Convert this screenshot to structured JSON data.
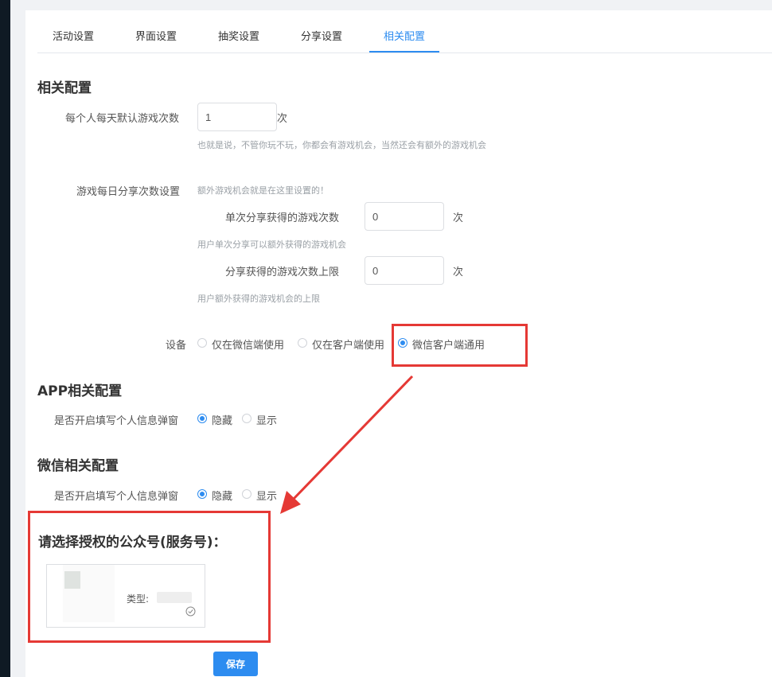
{
  "tabs": [
    {
      "label": "活动设置"
    },
    {
      "label": "界面设置"
    },
    {
      "label": "抽奖设置"
    },
    {
      "label": "分享设置"
    },
    {
      "label": "相关配置"
    }
  ],
  "related": {
    "title": "相关配置",
    "daily_plays_label": "每个人每天默认游戏次数",
    "daily_plays_value": "1",
    "daily_plays_unit": "次",
    "daily_plays_hint": "也就是说，不管你玩不玩，你都会有游戏机会，当然还会有额外的游戏机会",
    "share_label": "游戏每日分享次数设置",
    "share_desc": "额外游戏机会就是在这里设置的！",
    "single_share_label": "单次分享获得的游戏次数",
    "single_share_value": "0",
    "single_share_unit": "次",
    "single_share_hint": "用户单次分享可以额外获得的游戏机会",
    "share_limit_label": "分享获得的游戏次数上限",
    "share_limit_value": "0",
    "share_limit_unit": "次",
    "share_limit_hint": "用户额外获得的游戏机会的上限",
    "device_label": "设备",
    "device_options": [
      "仅在微信端使用",
      "仅在客户端使用",
      "微信客户端通用"
    ],
    "device_selected": "微信客户端通用"
  },
  "app": {
    "title": "APP相关配置",
    "popup_label": "是否开启填写个人信息弹窗",
    "options": [
      "隐藏",
      "显示"
    ],
    "selected": "隐藏"
  },
  "wechat": {
    "title": "微信相关配置",
    "popup_label": "是否开启填写个人信息弹窗",
    "options": [
      "隐藏",
      "显示"
    ],
    "selected": "隐藏"
  },
  "auth": {
    "title": "请选择授权的公众号(服务号)：",
    "account_type_label": "类型:"
  },
  "save_label": "保存",
  "colors": {
    "accent": "#2d8cf0",
    "annotation_red": "#e53935",
    "sidebar": "#0f1a24"
  },
  "icons": [
    "check-circle-icon"
  ]
}
